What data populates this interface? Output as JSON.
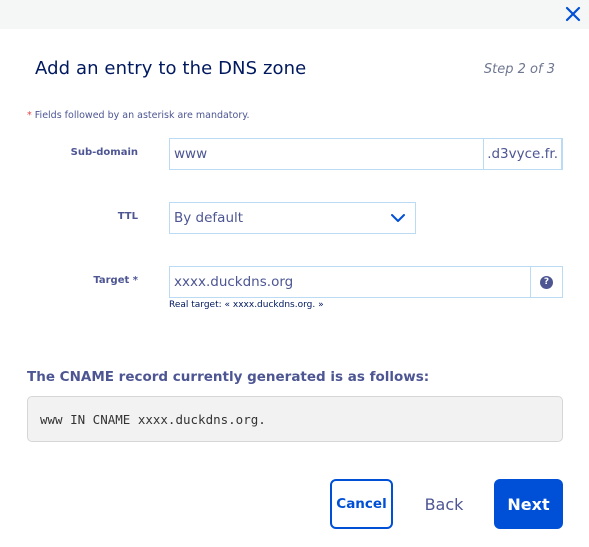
{
  "dialog": {
    "title": "Add an entry to the DNS zone",
    "step": "Step 2 of 3",
    "mandatory_star": "*",
    "mandatory_note": "Fields followed by an asterisk are mandatory."
  },
  "form": {
    "subdomain": {
      "label": "Sub-domain",
      "value": "www",
      "suffix": ".d3vyce.fr."
    },
    "ttl": {
      "label": "TTL",
      "value": "By default"
    },
    "target": {
      "label": "Target *",
      "value": "xxxx.duckdns.org",
      "help": "?",
      "real_target": "Real target: « xxxx.duckdns.org. »"
    }
  },
  "cname": {
    "heading": "The CNAME record currently generated is as follows:",
    "record": "www IN CNAME xxxx.duckdns.org."
  },
  "buttons": {
    "cancel": "Cancel",
    "back": "Back",
    "next": "Next"
  },
  "icons": {
    "close": "close-icon",
    "dropdown": "chevron-down-icon",
    "help": "help-icon"
  },
  "colors": {
    "accent": "#0050d7",
    "text": "#4d5693",
    "title": "#00185e",
    "border": "#bbdbf5"
  }
}
